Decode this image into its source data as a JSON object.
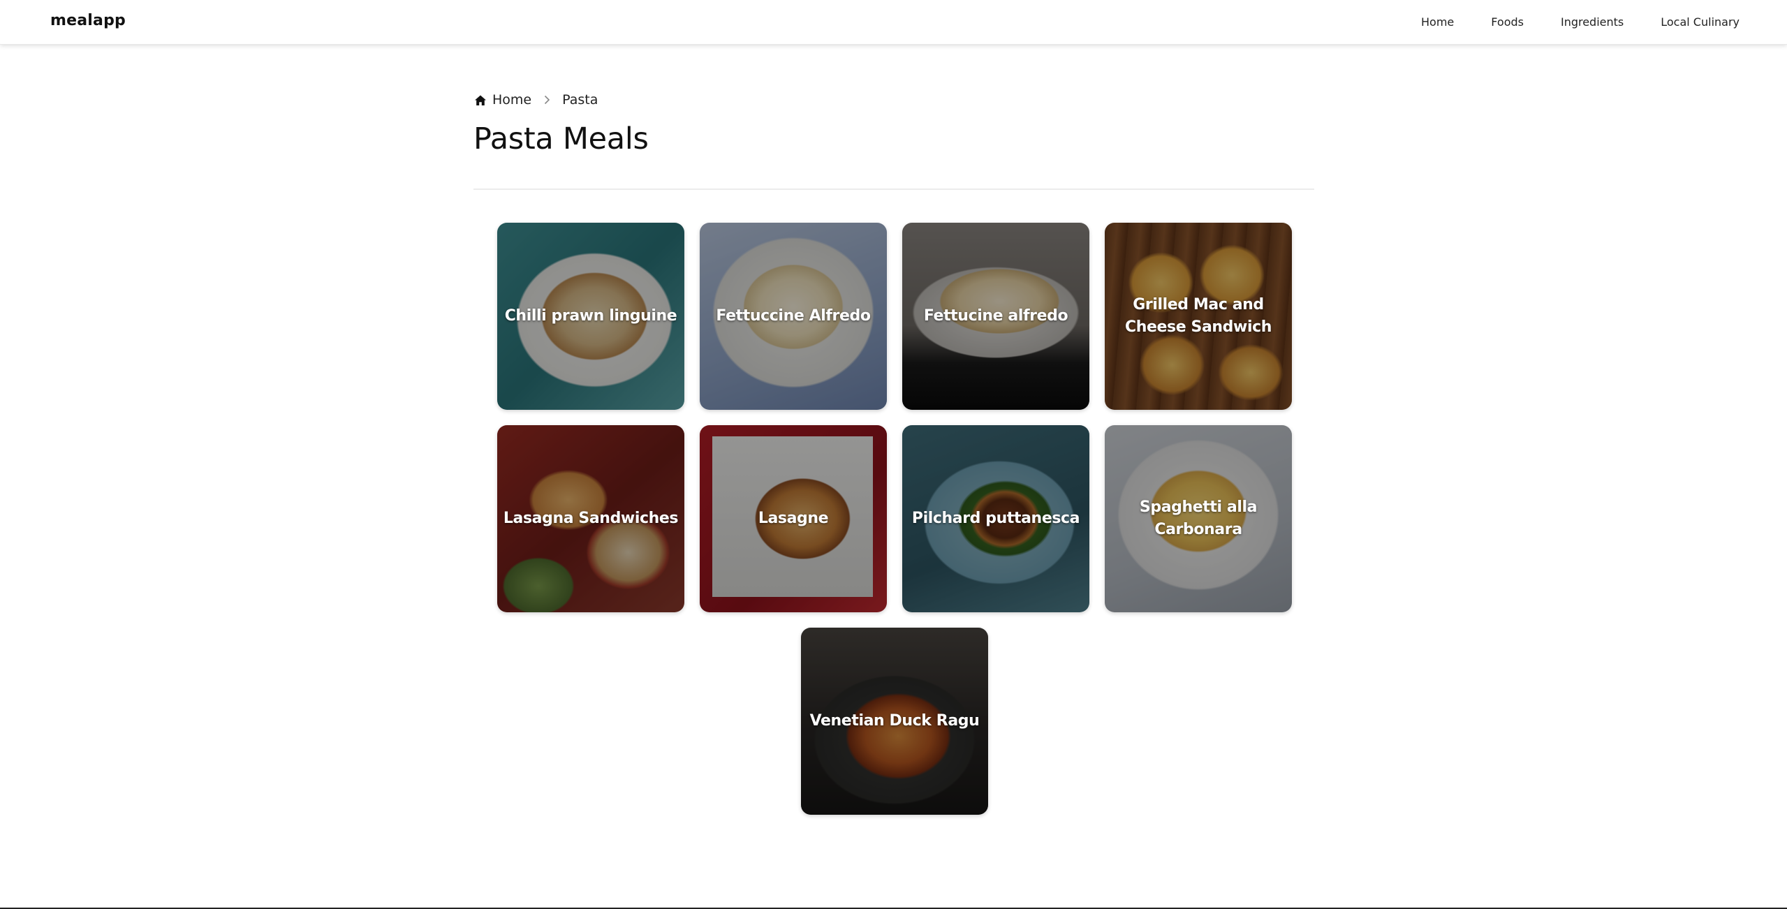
{
  "app": {
    "logo": "mealapp"
  },
  "nav": {
    "items": [
      {
        "label": "Home"
      },
      {
        "label": "Foods"
      },
      {
        "label": "Ingredients"
      },
      {
        "label": "Local Culinary"
      }
    ]
  },
  "breadcrumb": {
    "home_icon": "home-icon",
    "separator_icon": "chevron-right-icon",
    "home": "Home",
    "current": "Pasta"
  },
  "page": {
    "title": "Pasta Meals"
  },
  "meals": [
    {
      "name": "Chilli prawn linguine"
    },
    {
      "name": "Fettuccine Alfredo"
    },
    {
      "name": "Fettucine alfredo"
    },
    {
      "name": "Grilled Mac and Cheese Sandwich"
    },
    {
      "name": "Lasagna Sandwiches"
    },
    {
      "name": "Lasagne"
    },
    {
      "name": "Pilchard puttanesca"
    },
    {
      "name": "Spaghetti alla Carbonara"
    },
    {
      "name": "Venetian Duck Ragu"
    }
  ]
}
